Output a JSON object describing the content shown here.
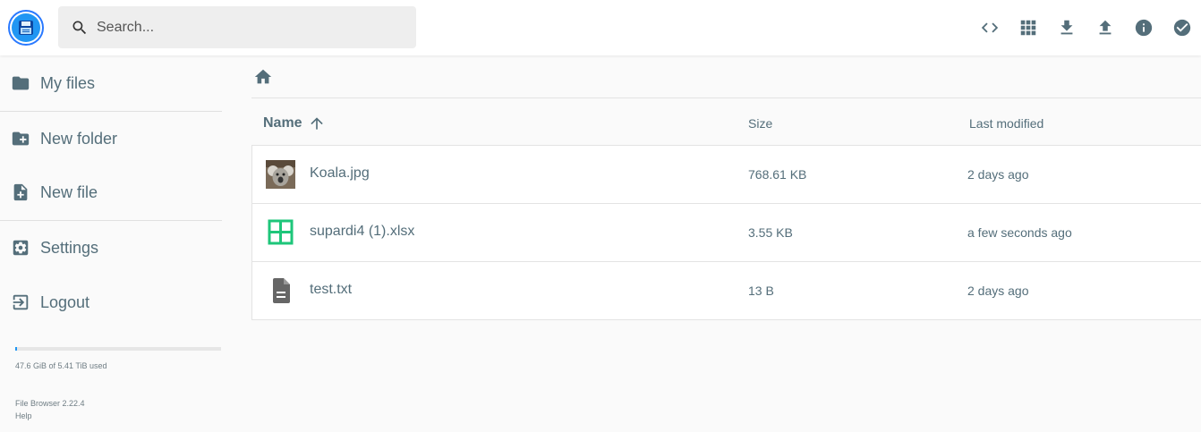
{
  "header": {
    "search_placeholder": "Search..."
  },
  "toolbar": {
    "buttons": [
      {
        "icon": "code-icon",
        "name": "toggle-source"
      },
      {
        "icon": "grid-view-icon",
        "name": "switch-view"
      },
      {
        "icon": "download-icon",
        "name": "download"
      },
      {
        "icon": "upload-icon",
        "name": "upload"
      },
      {
        "icon": "info-icon",
        "name": "info"
      },
      {
        "icon": "check-circle-icon",
        "name": "select-multiple"
      }
    ]
  },
  "sidebar": {
    "items": [
      {
        "label": "My files",
        "icon": "folder-icon"
      },
      {
        "label": "New folder",
        "icon": "new-folder-icon"
      },
      {
        "label": "New file",
        "icon": "new-file-icon"
      },
      {
        "label": "Settings",
        "icon": "settings-icon"
      },
      {
        "label": "Logout",
        "icon": "logout-icon"
      }
    ],
    "usage": {
      "text": "47.6 GiB of 5.41 TiB used",
      "fraction": 0.0086
    },
    "credits": {
      "version": "File Browser 2.22.4",
      "help": "Help"
    }
  },
  "listing": {
    "columns": {
      "name": "Name",
      "size": "Size",
      "modified": "Last modified"
    },
    "sort": {
      "column": "name",
      "direction": "ascending"
    },
    "files": [
      {
        "name": "Koala.jpg",
        "size": "768.61 KB",
        "modified": "2 days ago",
        "icon": "image-thumbnail-icon"
      },
      {
        "name": "supardi4 (1).xlsx",
        "size": "3.55 KB",
        "modified": "a few seconds ago",
        "icon": "spreadsheet-icon"
      },
      {
        "name": "test.txt",
        "size": "13 B",
        "modified": "2 days ago",
        "icon": "text-document-icon"
      }
    ]
  },
  "colors": {
    "accent": "#2196f3",
    "icon": "#546e7a",
    "spreadsheet": "#1ec67a"
  }
}
